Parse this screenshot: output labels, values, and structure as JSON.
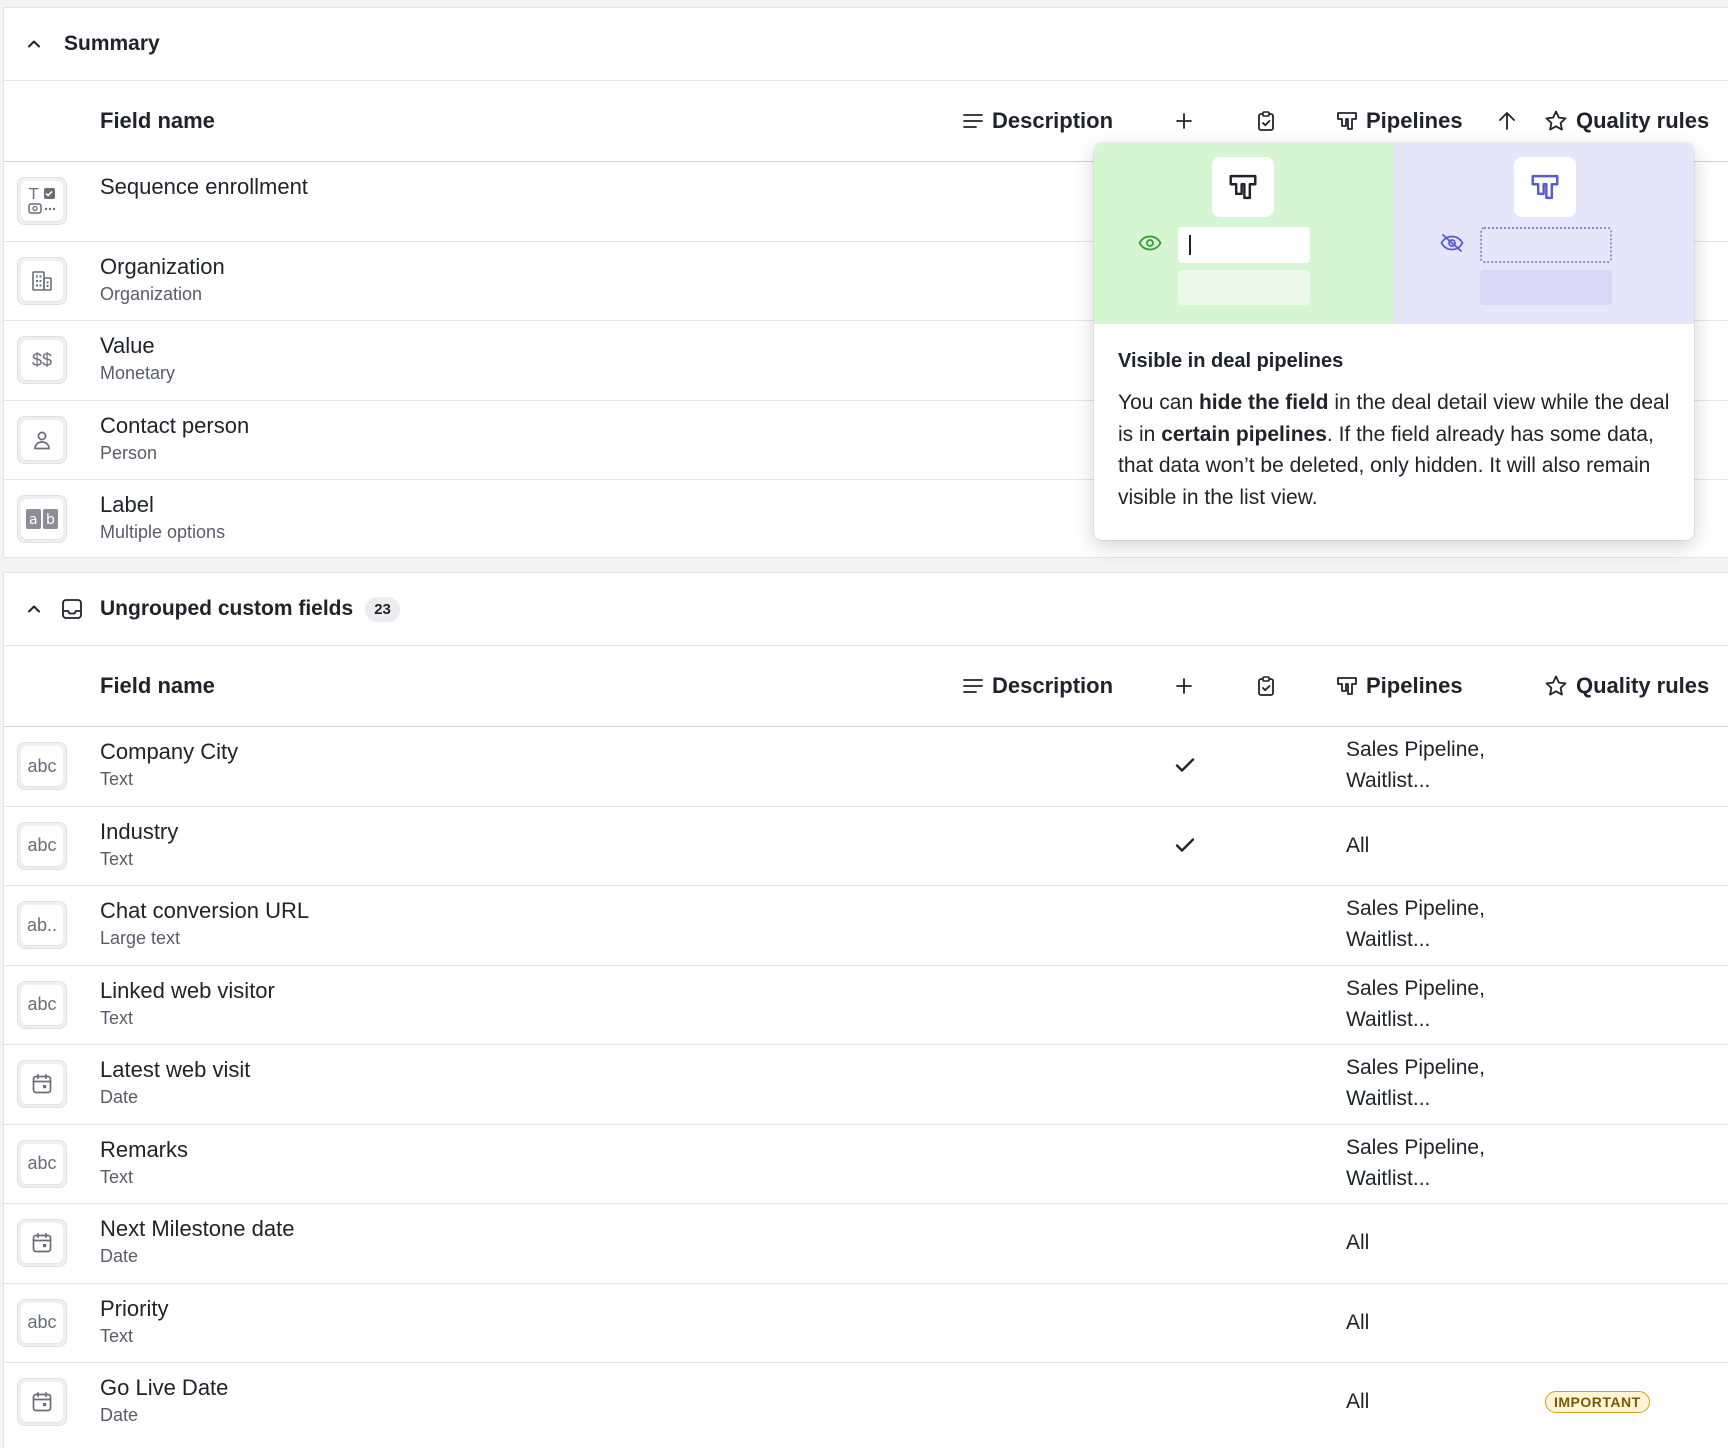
{
  "columns": {
    "field_name": "Field name",
    "description": "Description",
    "pipelines": "Pipelines",
    "quality_rules": "Quality rules"
  },
  "summary": {
    "title": "Summary",
    "rows": [
      {
        "name": "Sequence enrollment",
        "type": "",
        "icon": "multi-type-icon"
      },
      {
        "name": "Organization",
        "type": "Organization",
        "icon": "building-icon"
      },
      {
        "name": "Value",
        "type": "Monetary",
        "icon": "money-icon",
        "glyph": "$$"
      },
      {
        "name": "Contact person",
        "type": "Person",
        "icon": "person-icon"
      },
      {
        "name": "Label",
        "type": "Multiple options",
        "icon": "multiple-options-icon"
      }
    ]
  },
  "custom": {
    "title": "Ungrouped custom fields",
    "count": "23",
    "rows": [
      {
        "name": "Company City",
        "type": "Text",
        "icon": "text-icon",
        "glyph": "abc",
        "checked": true,
        "pipelines": "Sales Pipeline,\nWaitlist..."
      },
      {
        "name": "Industry",
        "type": "Text",
        "icon": "text-icon",
        "glyph": "abc",
        "checked": true,
        "pipelines": "All"
      },
      {
        "name": "Chat conversion URL",
        "type": "Large text",
        "icon": "large-text-icon",
        "glyph": "ab..",
        "checked": false,
        "pipelines": "Sales Pipeline,\nWaitlist..."
      },
      {
        "name": "Linked web visitor",
        "type": "Text",
        "icon": "text-icon",
        "glyph": "abc",
        "checked": false,
        "pipelines": "Sales Pipeline,\nWaitlist..."
      },
      {
        "name": "Latest web visit",
        "type": "Date",
        "icon": "calendar-icon",
        "checked": false,
        "pipelines": "Sales Pipeline,\nWaitlist..."
      },
      {
        "name": "Remarks",
        "type": "Text",
        "icon": "text-icon",
        "glyph": "abc",
        "checked": false,
        "pipelines": "Sales Pipeline,\nWaitlist..."
      },
      {
        "name": "Next Milestone date",
        "type": "Date",
        "icon": "calendar-icon",
        "checked": false,
        "pipelines": "All"
      },
      {
        "name": "Priority",
        "type": "Text",
        "icon": "text-icon",
        "glyph": "abc",
        "checked": false,
        "pipelines": "All"
      },
      {
        "name": "Go Live Date",
        "type": "Date",
        "icon": "calendar-icon",
        "checked": false,
        "pipelines": "All",
        "quality": "IMPORTANT"
      }
    ]
  },
  "popover": {
    "title": "Visible in deal pipelines",
    "body_parts": [
      {
        "text": "You can ",
        "bold": false
      },
      {
        "text": "hide the field",
        "bold": true
      },
      {
        "text": " in the deal detail view while the deal is in ",
        "bold": false
      },
      {
        "text": "certain pipelines",
        "bold": true
      },
      {
        "text": ". If the field already has some data, that data won’t be deleted, only hidden. It will also remain visible in the list view.",
        "bold": false
      }
    ],
    "colors": {
      "visible_bg": "#d6f5d3",
      "hidden_bg": "#e6e6fb",
      "visible_accent": "#3a9a3a",
      "hidden_accent": "#5a5acf"
    }
  }
}
